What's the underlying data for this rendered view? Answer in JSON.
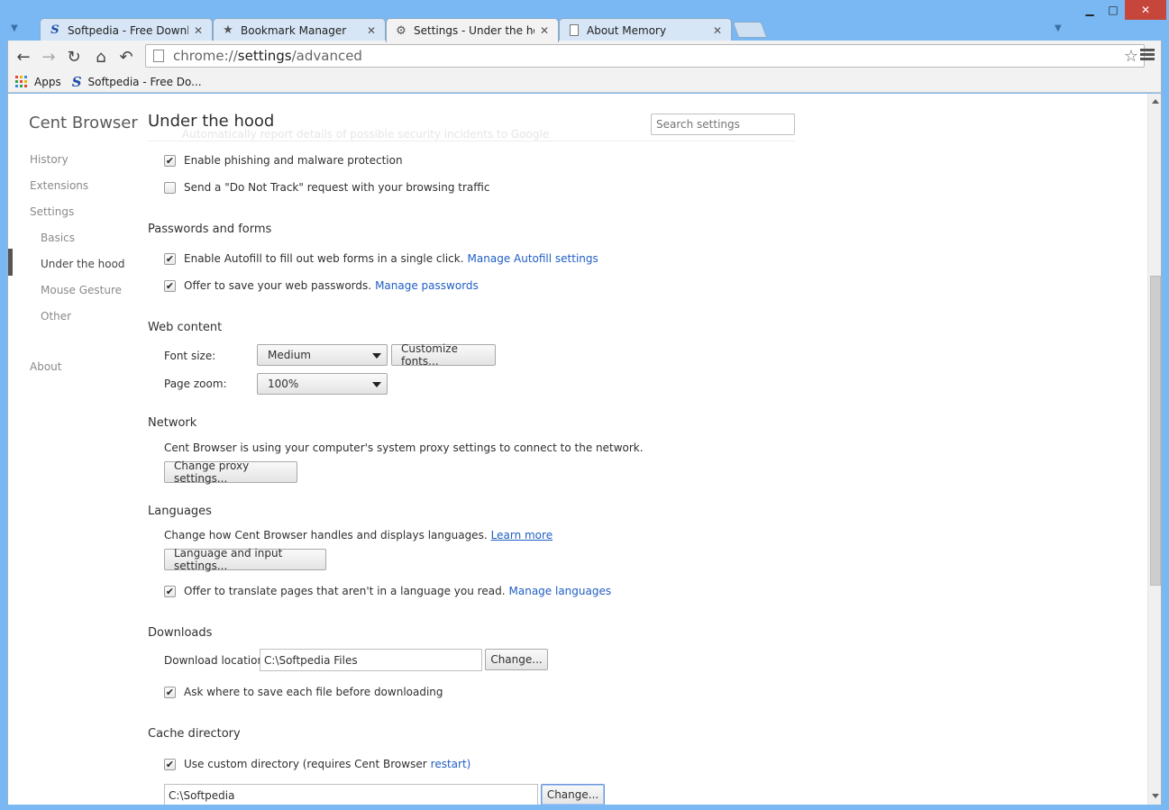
{
  "window": {
    "minimize": "▁",
    "maximize": "□",
    "close": "✕"
  },
  "tabs": [
    {
      "title": "Softpedia - Free Downloa",
      "icon": "softpedia-logo",
      "close": "✕"
    },
    {
      "title": "Bookmark Manager",
      "icon": "star-icon",
      "close": "✕"
    },
    {
      "title": "Settings - Under the hood",
      "icon": "gear-icon",
      "close": "✕"
    },
    {
      "title": "About Memory",
      "icon": "page-icon",
      "close": "✕"
    }
  ],
  "toolbar": {
    "url_scheme": "chrome://",
    "url_host": "settings",
    "url_path": "/advanced"
  },
  "bookmarks": [
    {
      "label": "Apps"
    },
    {
      "label": "Softpedia - Free Do..."
    }
  ],
  "sidebar": {
    "brand": "Cent Browser",
    "items": [
      {
        "label": "History"
      },
      {
        "label": "Extensions"
      },
      {
        "label": "Settings"
      },
      {
        "label": "Basics"
      },
      {
        "label": "Under the hood"
      },
      {
        "label": "Mouse Gesture"
      },
      {
        "label": "Other"
      },
      {
        "label": "About"
      }
    ]
  },
  "main": {
    "title": "Under the hood",
    "ghost_text": "Automatically report details of possible security incidents to Google",
    "search_placeholder": "Search settings",
    "privacy": {
      "phishing": "Enable phishing and malware protection",
      "dnt": "Send a \"Do Not Track\" request with your browsing traffic"
    },
    "passwords": {
      "title": "Passwords and forms",
      "autofill": "Enable Autofill to fill out web forms in a single click.",
      "autofill_link": "Manage Autofill settings",
      "save_pw": "Offer to save your web passwords.",
      "save_pw_link": "Manage passwords"
    },
    "web_content": {
      "title": "Web content",
      "font_size_label": "Font size:",
      "font_size_value": "Medium",
      "customize_fonts": "Customize fonts...",
      "page_zoom_label": "Page zoom:",
      "page_zoom_value": "100%"
    },
    "network": {
      "title": "Network",
      "desc": "Cent Browser is using your computer's system proxy settings to connect to the network.",
      "button": "Change proxy settings..."
    },
    "languages": {
      "title": "Languages",
      "desc": "Change how Cent Browser handles and displays languages.",
      "learn_more": "Learn more",
      "button": "Language and input settings...",
      "translate": "Offer to translate pages that aren't in a language you read.",
      "translate_link": "Manage languages"
    },
    "downloads": {
      "title": "Downloads",
      "location_label": "Download location:",
      "location_value": "C:\\Softpedia Files",
      "change": "Change...",
      "ask": "Ask where to save each file before downloading"
    },
    "cache": {
      "title": "Cache directory",
      "custom": "Use custom directory (requires Cent Browser",
      "restart": "restart)",
      "path": "C:\\Softpedia",
      "change": "Change..."
    }
  },
  "checks": {
    "mark": "✔"
  }
}
